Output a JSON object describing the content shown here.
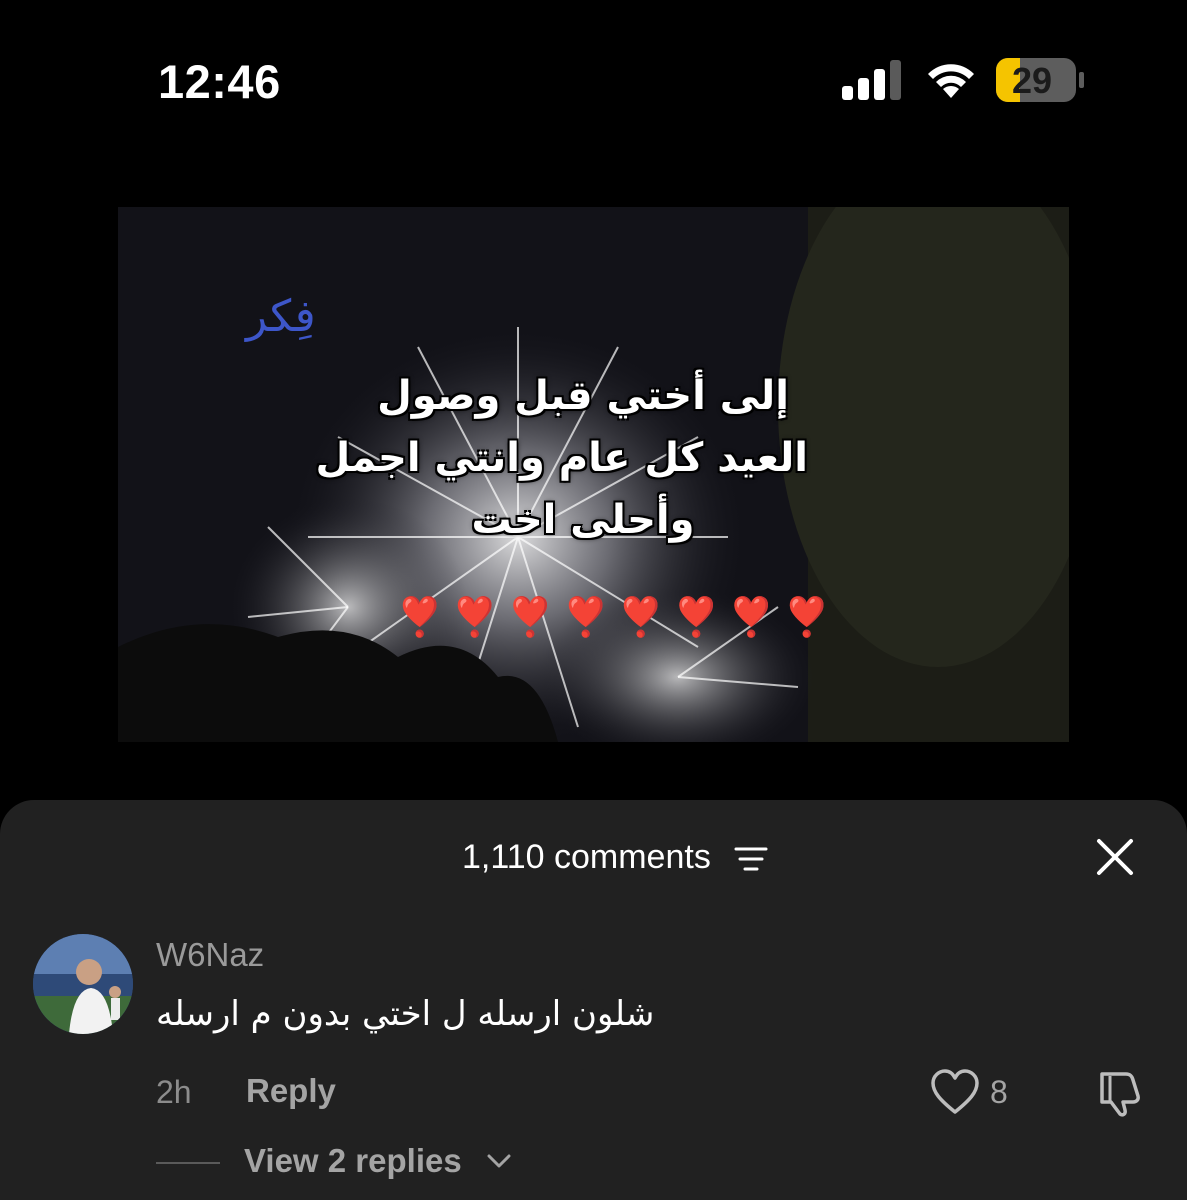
{
  "status_bar": {
    "time": "12:46",
    "battery": "29"
  },
  "video": {
    "brand_mark": "فِكر",
    "caption_lines": [
      "إلى أختي قبل وصول",
      "العيد كل عام وانتي اجمل",
      "وأحلى اخت"
    ],
    "hearts": "❣️❣️❣️❣️❣️❣️❣️❣️"
  },
  "comments_sheet": {
    "title": "1,110 comments"
  },
  "comment": {
    "username": "W6Naz",
    "text": "شلون ارسله ل اختي بدون م ارسله",
    "time_ago": "2h",
    "reply_label": "Reply",
    "like_count": "8",
    "view_replies": "View 2 replies"
  }
}
